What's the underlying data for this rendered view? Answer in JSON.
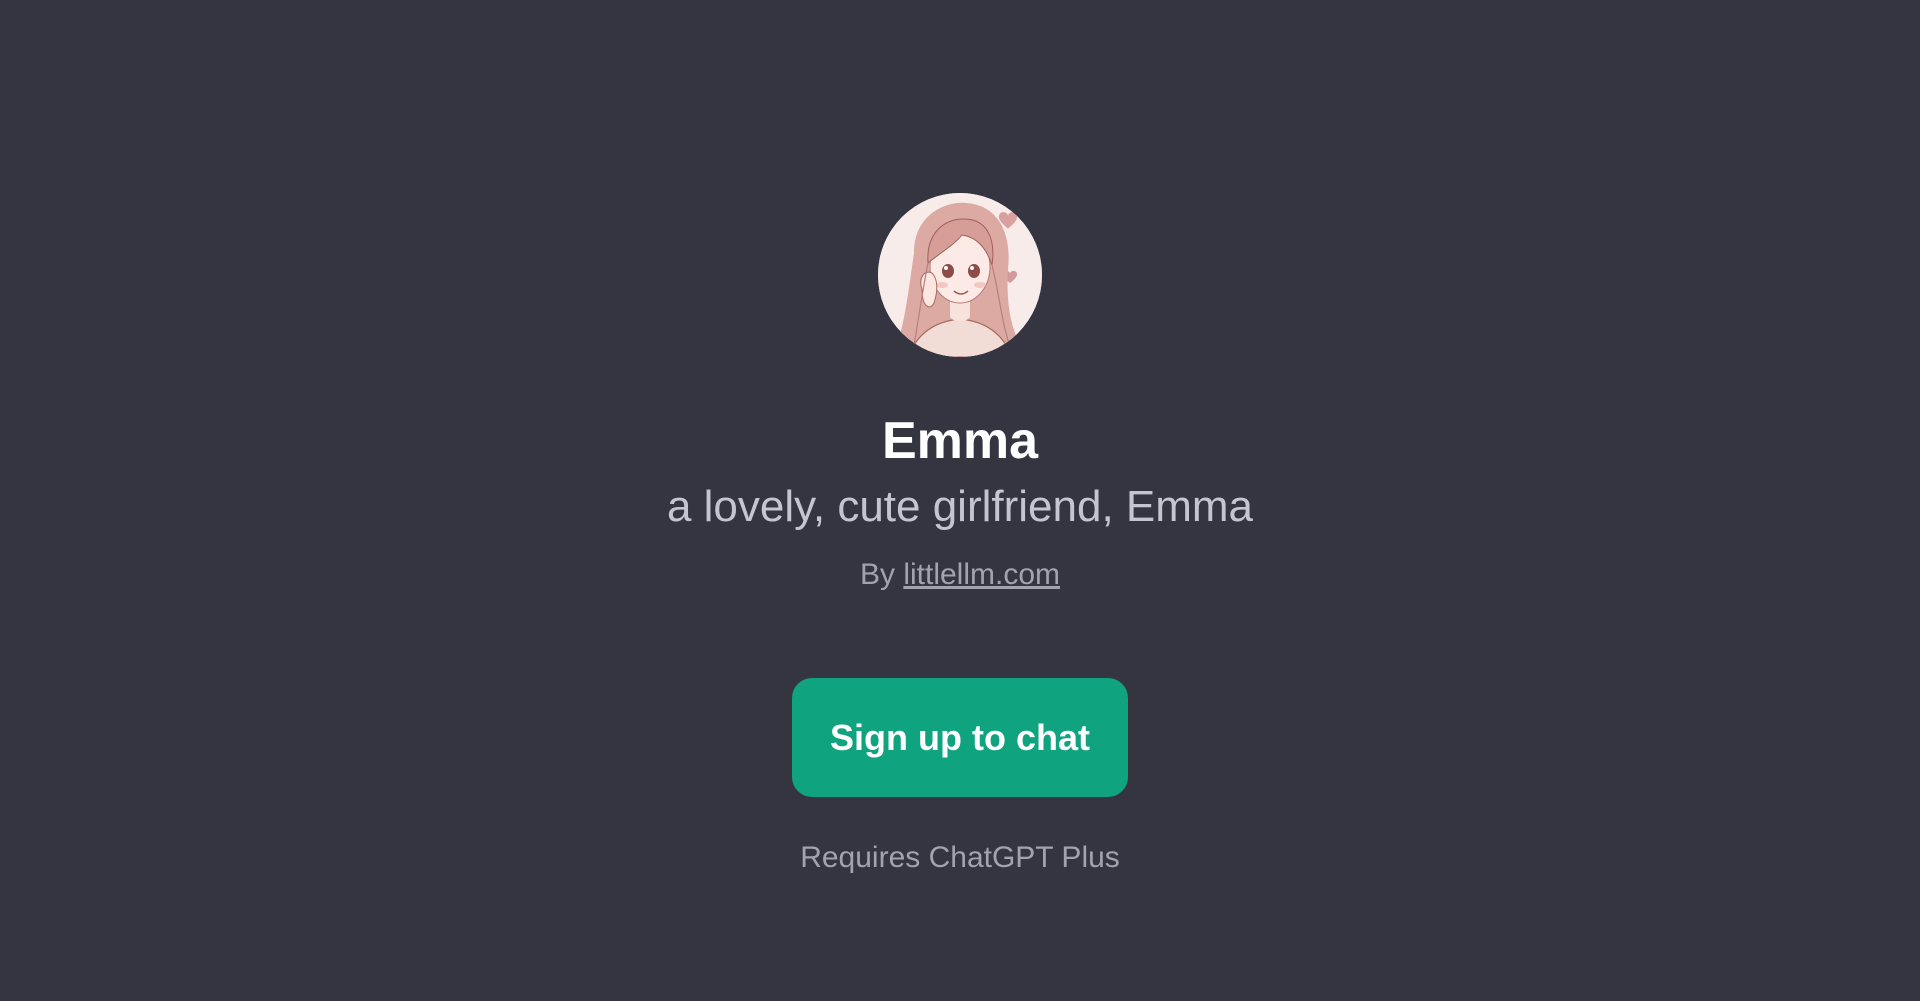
{
  "gpt": {
    "name": "Emma",
    "description": "a lovely, cute girlfriend, Emma",
    "by_prefix": "By",
    "author_link": "littlellm.com",
    "avatar_icon": "anime-girl-portrait"
  },
  "cta": {
    "signup_label": "Sign up to chat",
    "requirement": "Requires ChatGPT Plus"
  },
  "colors": {
    "background": "#343541",
    "button": "#10a37f",
    "title": "#ffffff",
    "subtitle": "#c5c5d2",
    "muted": "#a3a3b0"
  }
}
